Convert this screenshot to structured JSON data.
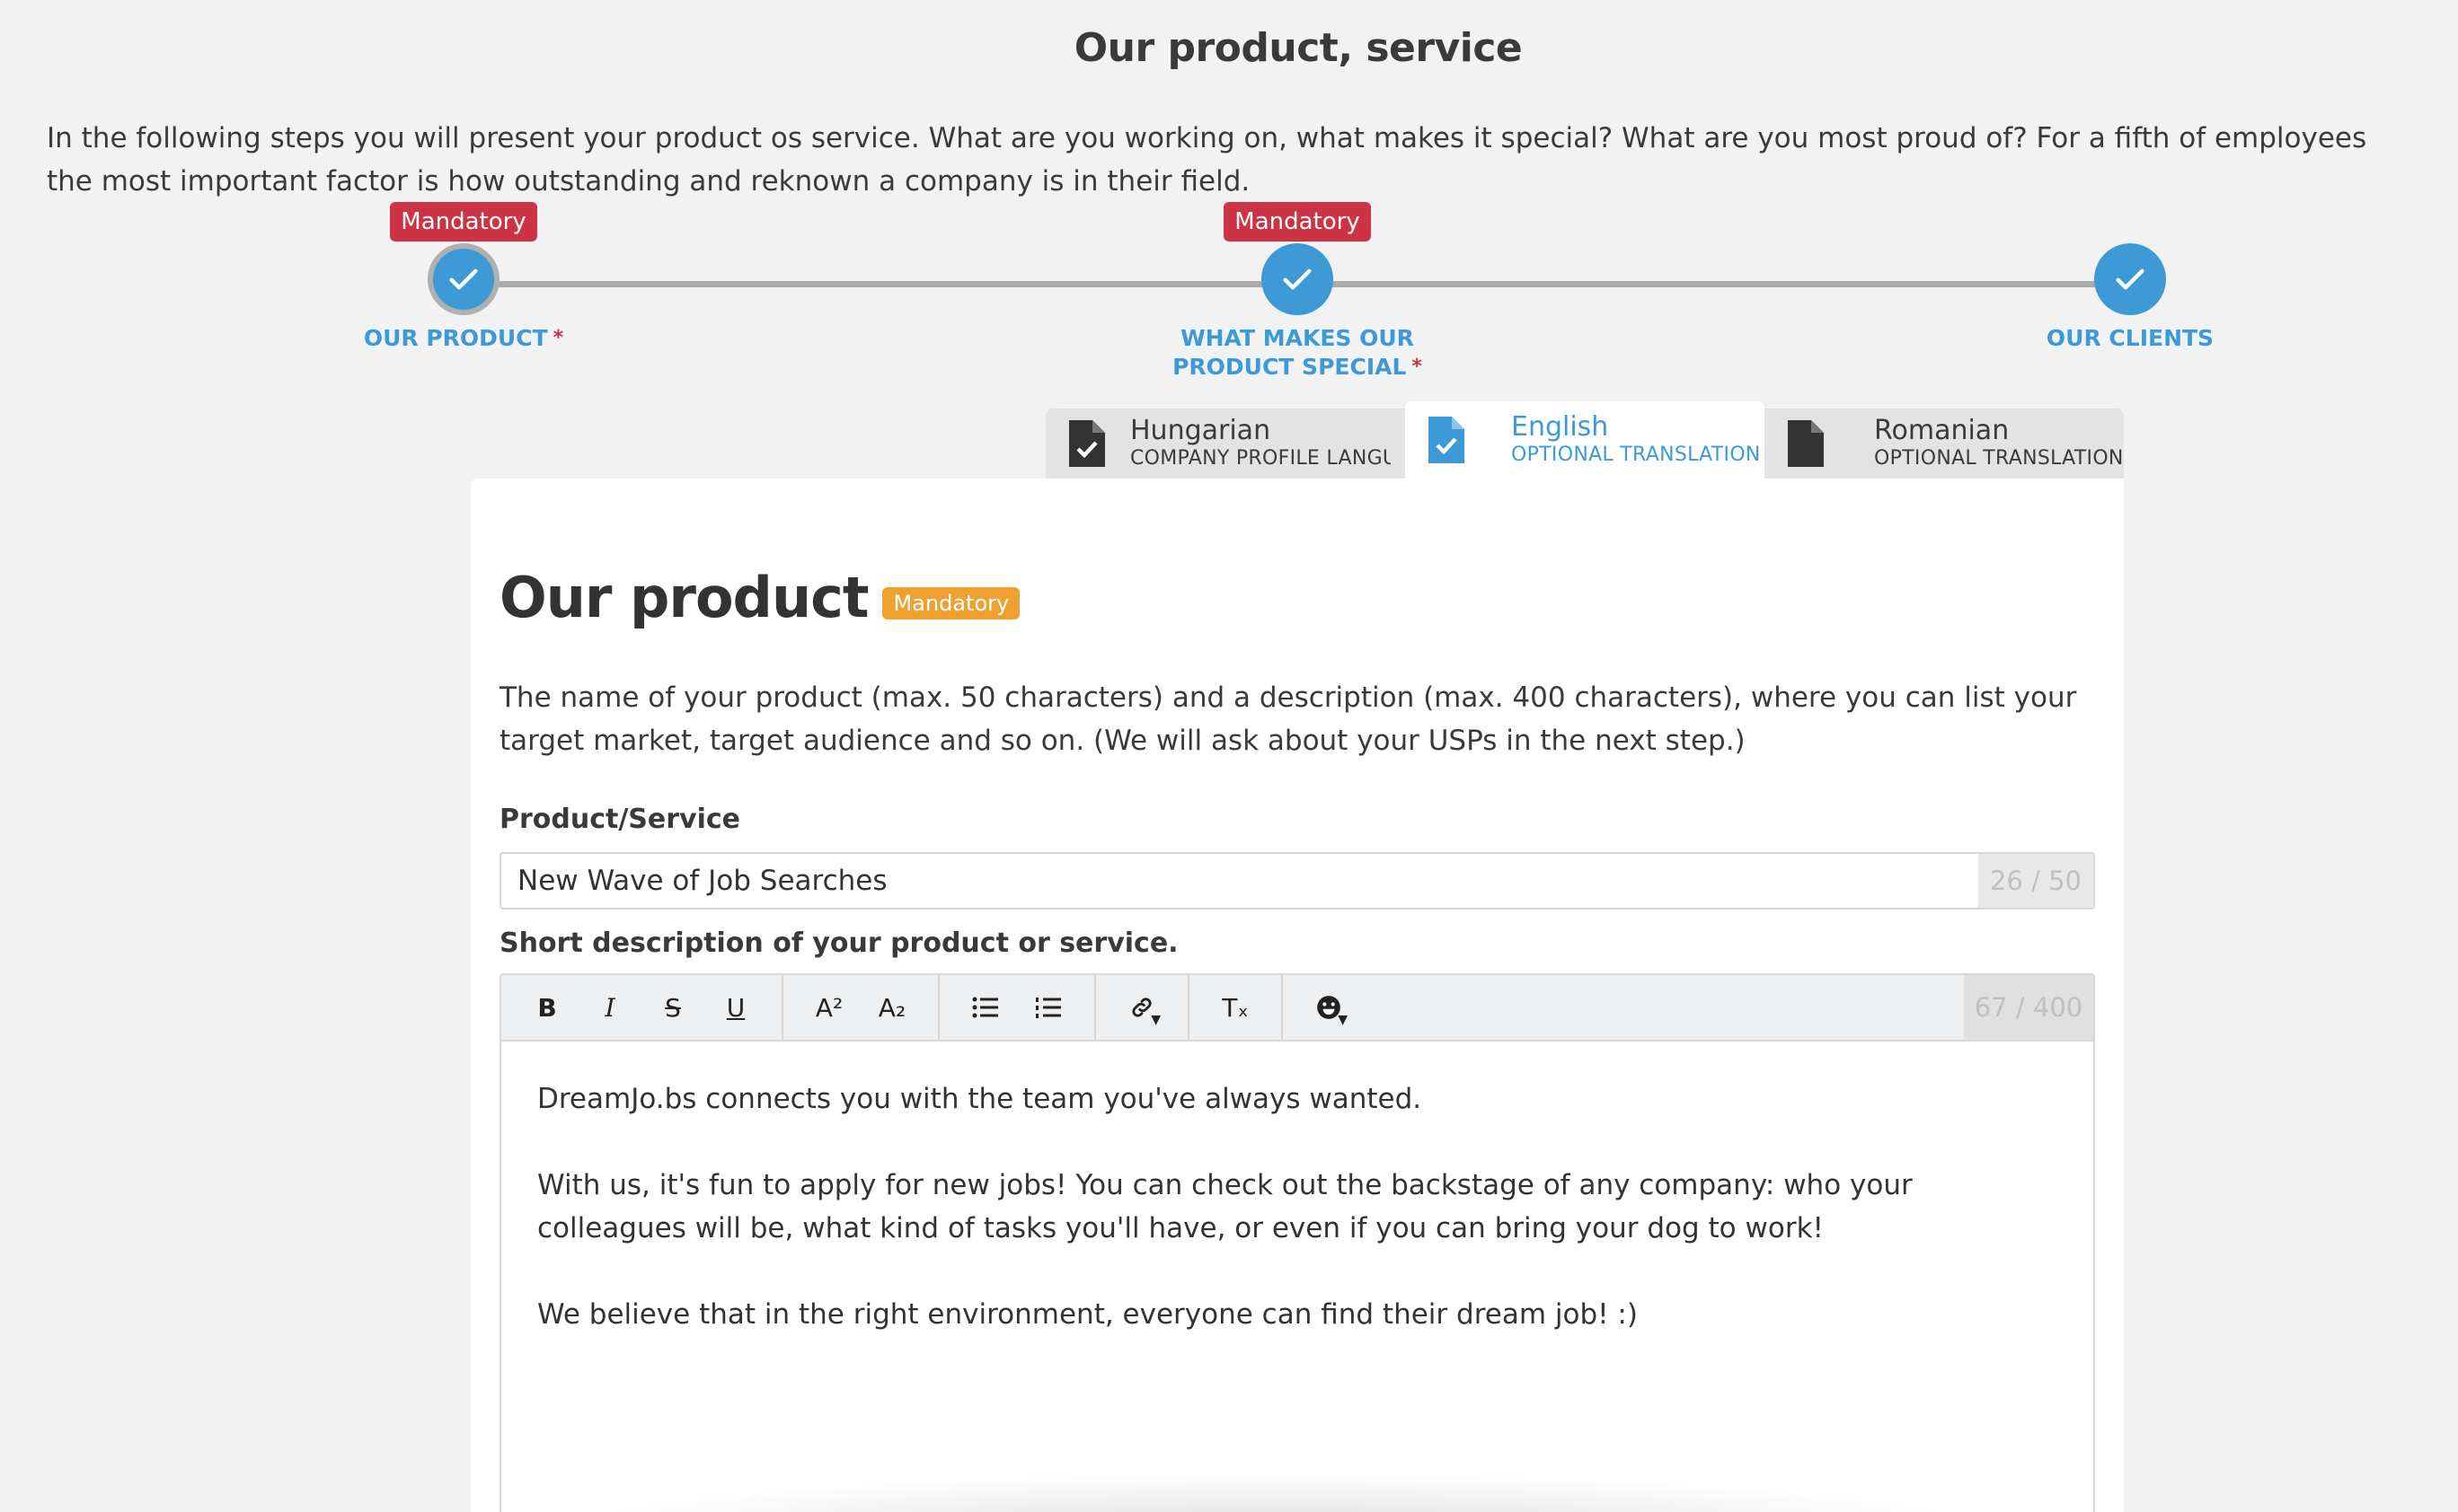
{
  "page": {
    "title": "Our product, service",
    "intro": "In the following steps you will present your product os service. What are you working on, what makes it special? What are you most proud of? For a fifth of employees the most important factor is how outstanding and reknown a company is in their field."
  },
  "stepper": {
    "steps": [
      {
        "label": "OUR PRODUCT",
        "badge": "Mandatory",
        "required": "*"
      },
      {
        "label": "WHAT MAKES OUR PRODUCT SPECIAL",
        "badge": "Mandatory",
        "required": "*"
      },
      {
        "label": "OUR CLIENTS",
        "badge": "",
        "required": ""
      }
    ]
  },
  "tabs": [
    {
      "name": "Hungarian",
      "sub": "COMPANY PROFILE LANGUAG",
      "icon": "document-check-icon"
    },
    {
      "name": "English",
      "sub": "OPTIONAL TRANSLATION",
      "icon": "document-check-icon"
    },
    {
      "name": "Romanian",
      "sub": "OPTIONAL TRANSLATION",
      "icon": "document-icon"
    }
  ],
  "section": {
    "title": "Our product",
    "badge": "Mandatory",
    "description": "The name of your product (max. 50 characters) and a description (max. 400 characters), where you can list your target market, target audience and so on. (We will ask about your USPs in the next step.)"
  },
  "product_field": {
    "label": "Product/Service",
    "value": "New Wave of Job Searches",
    "counter": "26 / 50"
  },
  "description_field": {
    "label": "Short description of your product or service.",
    "counter": "67 / 400",
    "toolbar": {
      "bold": "B",
      "italic": "I",
      "strike": "S",
      "underline": "U",
      "superscript": "A²",
      "subscript": "A₂",
      "clear": "Tₓ"
    },
    "paragraphs": [
      "DreamJo.bs connects you with the team you've always wanted.",
      "With us, it's fun to apply for new jobs! You can check out the backstage of any company: who your colleagues will be, what kind of tasks you'll have, or even if you can bring your dog to work!",
      "We believe that in the right environment, everyone can find their dream job! :)"
    ]
  },
  "colors": {
    "accent": "#3d9ad6",
    "mandatory_red": "#cc3344",
    "mandatory_orange": "#f0a030"
  }
}
